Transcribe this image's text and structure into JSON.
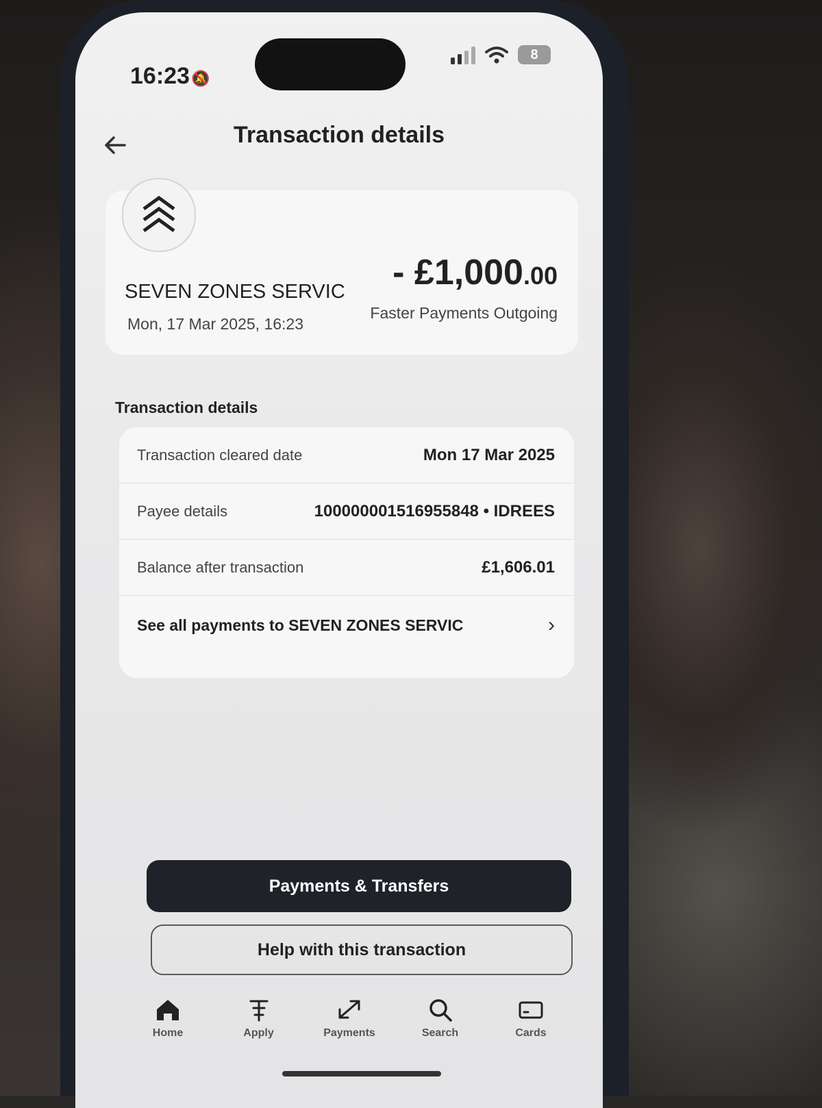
{
  "status_bar": {
    "time": "16:23",
    "battery": "8"
  },
  "header": {
    "back_icon": "arrow-left-icon",
    "title": "Transaction details"
  },
  "summary": {
    "logo_icon": "triple-chevron-up-logo",
    "merchant": "SEVEN ZONES SERVIC",
    "datetime": "Mon, 17 Mar 2025, 16:23",
    "amount_main": "- £1,000",
    "amount_pence": ".00",
    "payment_type": "Faster Payments Outgoing"
  },
  "details": {
    "heading": "Transaction details",
    "rows": [
      {
        "label": "Transaction cleared date",
        "value": "Mon 17 Mar 2025"
      },
      {
        "label": "Payee details",
        "value": "100000001516955848 • IDREES"
      },
      {
        "label": "Balance after transaction",
        "value": "£1,606.01"
      }
    ],
    "see_all_label": "See all payments to SEVEN ZONES SERVIC"
  },
  "actions": {
    "primary_label": "Payments & Transfers",
    "secondary_label": "Help with this transaction"
  },
  "tabbar": {
    "items": [
      {
        "label": "Home",
        "icon": "home-icon"
      },
      {
        "label": "Apply",
        "icon": "apply-icon"
      },
      {
        "label": "Payments",
        "icon": "payments-icon"
      },
      {
        "label": "Search",
        "icon": "search-icon"
      },
      {
        "label": "Cards",
        "icon": "card-icon"
      }
    ]
  }
}
